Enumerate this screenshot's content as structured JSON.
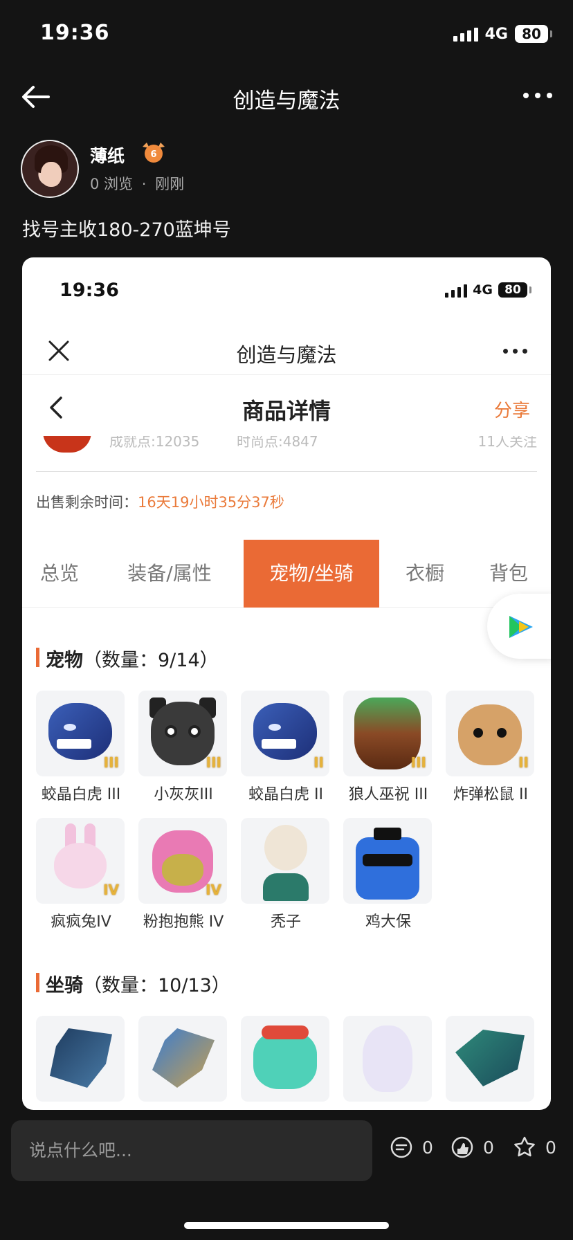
{
  "status_bar": {
    "time": "19:36",
    "network": "4G",
    "battery": "80"
  },
  "nav": {
    "title": "创造与魔法"
  },
  "author": {
    "name": "薄纸",
    "level": "6",
    "views": "0 浏览",
    "dot": "·",
    "time": "刚刚"
  },
  "post": {
    "text": "找号主收180-270蓝坤号"
  },
  "screenshot": {
    "status_bar": {
      "time": "19:36",
      "network": "4G",
      "battery": "80"
    },
    "nav_title": "创造与魔法",
    "page_title": "商品详情",
    "share_label": "分享",
    "cut_stats": [
      "成就点:12035",
      "时尚点:4847",
      "11人关注"
    ],
    "remaining_label": "出售剩余时间：",
    "remaining_value": "16天19小时35分37秒",
    "tabs": [
      {
        "label": "总览",
        "active": false
      },
      {
        "label": "装备/属性",
        "active": false
      },
      {
        "label": "宠物/坐骑",
        "active": true
      },
      {
        "label": "衣橱",
        "active": false
      },
      {
        "label": "背包",
        "active": false
      }
    ],
    "pets_section": {
      "title": "宠物",
      "count": "（数量：9/14）"
    },
    "pets": [
      {
        "label": "蛟晶白虎 III",
        "art": "tiger",
        "roman": "III"
      },
      {
        "label": "小灰灰III",
        "art": "grey",
        "roman": "III"
      },
      {
        "label": "蛟晶白虎 II",
        "art": "tiger",
        "roman": "II"
      },
      {
        "label": "狼人巫祝 III",
        "art": "wolf",
        "roman": "III"
      },
      {
        "label": "炸弹松鼠 II",
        "art": "squirrel",
        "roman": "II"
      },
      {
        "label": "疯疯兔IV",
        "art": "bunny",
        "roman": "IV"
      },
      {
        "label": "粉抱抱熊 IV",
        "art": "bear",
        "roman": "IV"
      },
      {
        "label": "秃子",
        "art": "bald",
        "roman": ""
      },
      {
        "label": "鸡大保",
        "art": "chick",
        "roman": ""
      }
    ],
    "mounts_section": {
      "title": "坐骑",
      "count": "（数量：10/13）"
    },
    "mounts": [
      {
        "art": "dragon1"
      },
      {
        "art": "dragon2"
      },
      {
        "art": "blob"
      },
      {
        "art": "ghost"
      },
      {
        "art": "dragon3"
      }
    ],
    "accent_color": "#ea6a35"
  },
  "bottom_bar": {
    "placeholder": "说点什么吧...",
    "comments": "0",
    "likes": "0",
    "favorites": "0"
  }
}
